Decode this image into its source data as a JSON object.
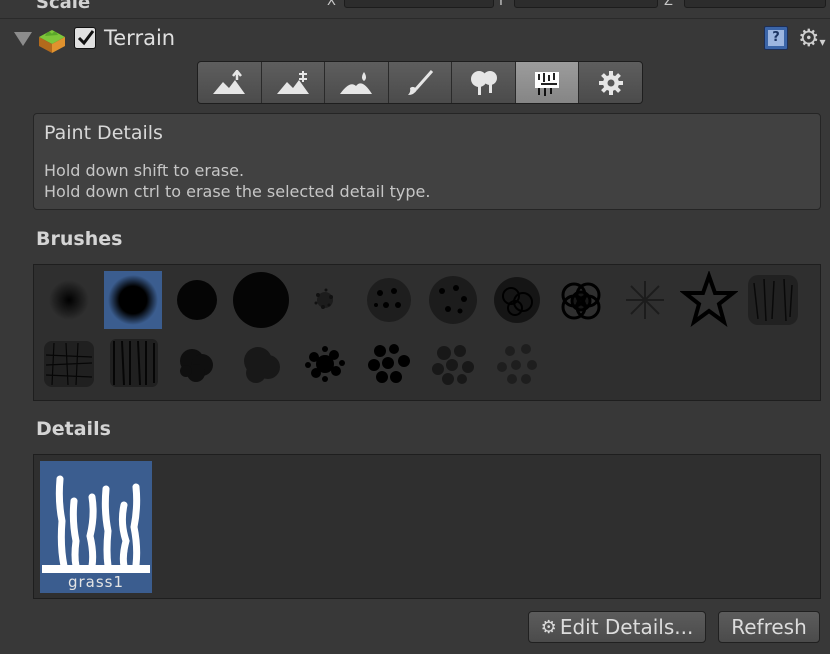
{
  "window": {
    "cut_label": "Scale",
    "axes": [
      "X",
      "Y",
      "Z"
    ]
  },
  "component": {
    "title": "Terrain",
    "enabled": true,
    "icons": [
      "terrain-icon",
      "help-icon",
      "gear-icon"
    ]
  },
  "toolbar": {
    "tools": [
      {
        "name": "raise-lower-terrain",
        "icon": "mountain-up-icon"
      },
      {
        "name": "paint-height",
        "icon": "mountain-height-icon"
      },
      {
        "name": "smooth-height",
        "icon": "mountain-smooth-icon"
      },
      {
        "name": "paint-texture",
        "icon": "brush-icon"
      },
      {
        "name": "place-trees",
        "icon": "tree-icon"
      },
      {
        "name": "paint-details",
        "icon": "details-icon"
      },
      {
        "name": "terrain-settings",
        "icon": "gear-icon"
      }
    ],
    "selected_index": 5
  },
  "helpbox": {
    "title": "Paint Details",
    "line1": "Hold down shift to erase.",
    "line2": "Hold down ctrl to erase the selected detail type."
  },
  "brushes": {
    "label": "Brushes",
    "selected_index": 1,
    "count": 20
  },
  "details": {
    "label": "Details",
    "items": [
      {
        "name": "grass1"
      }
    ]
  },
  "buttons": {
    "edit_details": "Edit Details...",
    "refresh": "Refresh"
  },
  "colors": {
    "selection": "#3b5d8f",
    "panel": "#383838"
  }
}
